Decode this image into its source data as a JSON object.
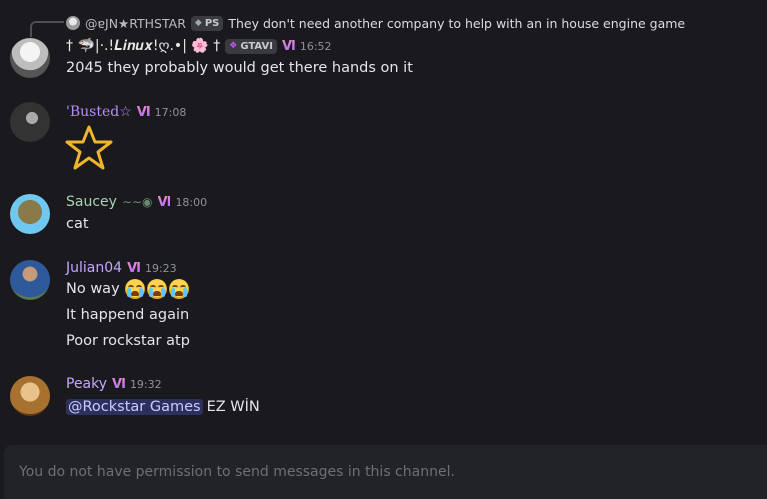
{
  "reply": {
    "author": "@ɐJN★RTHSTAR",
    "tag": "PS",
    "text": "They don't need another company to help with an in house engine game"
  },
  "messages": [
    {
      "author": "† 🦈|·.!𝑳𝒊𝒏𝒖𝒙!ღ.•| 🌸 †",
      "author_color": "#e8e8e8",
      "guild_tag": "GTAVI",
      "badge": "VI",
      "time": "16:52",
      "lines": [
        "2045 they probably would get there hands on it"
      ]
    },
    {
      "author": "'Busted☆",
      "author_color": "#b58cff",
      "badge": "VI",
      "time": "17:08",
      "lines": []
    },
    {
      "author": "Saucey",
      "author_color": "#a9d1b4",
      "badge": "VI",
      "time": "18:00",
      "lines": [
        "cat"
      ]
    },
    {
      "author": "Julian04",
      "author_color": "#c3a7ff",
      "badge": "VI",
      "time": "19:23",
      "lines": [
        "No way",
        "It happend again",
        "Poor rockstar atp"
      ]
    },
    {
      "author": "Peaky",
      "author_color": "#c3a7ff",
      "badge": "VI",
      "time": "19:32",
      "mention": "@Rockstar Games",
      "lines": [
        "EZ WİN"
      ]
    }
  ],
  "input": {
    "placeholder": "You do not have permission to send messages in this channel."
  },
  "colors": {
    "background": "#1a1a1e",
    "mention_bg": "#3b3f7a",
    "star": "#f1b52b"
  },
  "icons": [
    "trophy-icon",
    "star-emoji",
    "loudly-crying-face-emoji",
    "nitro-gem-icon"
  ]
}
